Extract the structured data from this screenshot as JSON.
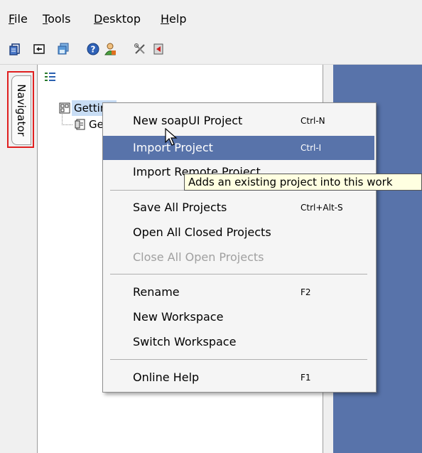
{
  "menubar": {
    "items": [
      {
        "mnemonic": "F",
        "rest": "ile"
      },
      {
        "mnemonic": "T",
        "rest": "ools"
      },
      {
        "mnemonic": "D",
        "rest": "esktop"
      },
      {
        "mnemonic": "H",
        "rest": "elp"
      }
    ]
  },
  "toolbar": {
    "icons": [
      "new-project-icon",
      "import-icon",
      "save-all-icon",
      "help-icon",
      "user-icon",
      "preferences-icon",
      "exit-icon"
    ]
  },
  "navigator_tab": {
    "label": "Navigator"
  },
  "tree": {
    "root_label": "Getting",
    "child_label": "Get"
  },
  "context_menu": {
    "items": [
      {
        "label": "New soapUI Project",
        "shortcut": "Ctrl-N"
      },
      {
        "label": "Import Project",
        "shortcut": "Ctrl-I"
      },
      {
        "label": "Import Remote Project",
        "shortcut": ""
      },
      {
        "label": "Save All Projects",
        "shortcut": "Ctrl+Alt-S"
      },
      {
        "label": "Open All Closed Projects",
        "shortcut": ""
      },
      {
        "label": "Close All Open Projects",
        "shortcut": ""
      },
      {
        "label": "Rename",
        "shortcut": "F2"
      },
      {
        "label": "New Workspace",
        "shortcut": ""
      },
      {
        "label": "Switch Workspace",
        "shortcut": ""
      },
      {
        "label": "Online Help",
        "shortcut": "F1"
      }
    ],
    "highlighted_index": 1,
    "disabled_index": 5
  },
  "tooltip": {
    "text": "Adds an existing project into this work"
  },
  "colors": {
    "highlight": "#5873aa",
    "tree_selection": "#c8ddf5",
    "annotation_border": "#e02020"
  }
}
